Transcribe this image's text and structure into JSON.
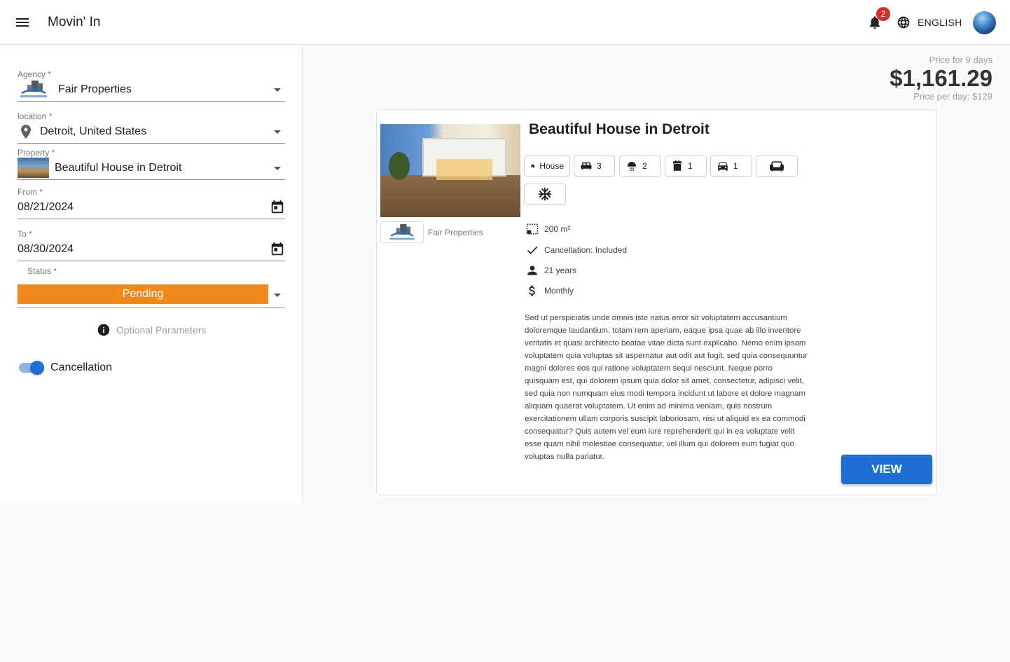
{
  "app": {
    "title": "Movin' In"
  },
  "header": {
    "notifications_count": "2",
    "language": "ENGLISH"
  },
  "form": {
    "agency": {
      "label": "Agency *",
      "value": "Fair Properties"
    },
    "location": {
      "label": "location *",
      "value": "Detroit, United States"
    },
    "property": {
      "label": "Property *",
      "value": "Beautiful House in Detroit"
    },
    "from": {
      "label": "From *",
      "value": "08/21/2024"
    },
    "to": {
      "label": "To *",
      "value": "08/30/2024"
    },
    "status": {
      "label": "Status *",
      "value": "Pending",
      "color": "#ef8a1a"
    },
    "optional_params": "Optional Parameters",
    "cancellation": {
      "label": "Cancellation",
      "enabled": true
    }
  },
  "price": {
    "days_label": "Price for 9 days",
    "total": "$1,161.29",
    "per_day": "Price per day: $129"
  },
  "card": {
    "title": "Beautiful House in Detroit",
    "agency_name": "Fair Properties",
    "features": {
      "type": "House",
      "bedrooms": "3",
      "bathrooms": "2",
      "kitchens": "1",
      "parking": "1"
    },
    "specs": {
      "size": "200 m²",
      "cancellation": "Cancellation: Included",
      "min_age": "21 years",
      "rental_term": "Monthly"
    },
    "description": "Sed ut perspiciatis unde omnis iste natus error sit voluptatem accusantium doloremque laudantium, totam rem aperiam, eaque ipsa quae ab illo inventore veritatis et quasi architecto beatae vitae dicta sunt explicabo. Nemo enim ipsam voluptatem quia voluptas sit aspernatur aut odit aut fugit, sed quia consequuntur magni dolores eos qui ratione voluptatem sequi nesciunt. Neque porro quisquam est, qui dolorem ipsum quia dolor sit amet, consectetur, adipisci velit, sed quia non numquam eius modi tempora incidunt ut labore et dolore magnam aliquam quaerat voluptatem. Ut enim ad minima veniam, quis nostrum exercitationem ullam corporis suscipit laboriosam, nisi ut aliquid ex ea commodi consequatur? Quis autem vel eum iure reprehenderit qui in ea voluptate velit esse quam nihil molestiae consequatur, vel illum qui dolorem eum fugiat quo voluptas nulla pariatur.",
    "view_label": "VIEW"
  },
  "colors": {
    "primary": "#1f6ed4",
    "pending": "#ef8a1a",
    "badge": "#d32f2f"
  }
}
